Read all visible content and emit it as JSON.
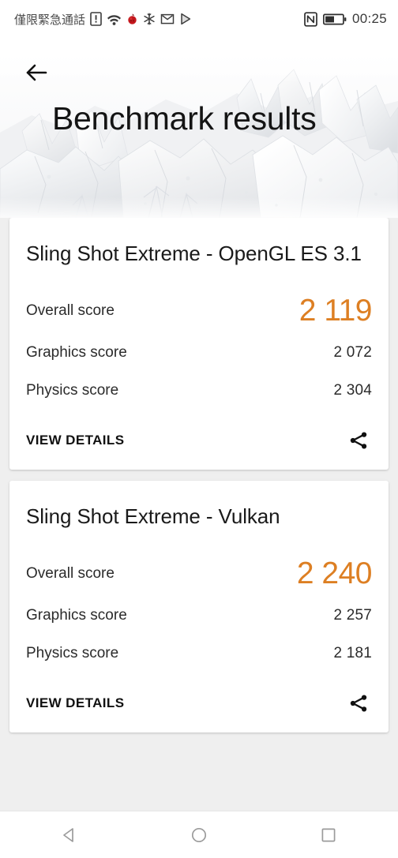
{
  "statusbar": {
    "carrier": "僅限緊急通話",
    "time": "00:25",
    "icons": [
      "sim-alert-icon",
      "wifi-icon",
      "app-notification-icon",
      "snowflake-icon",
      "gmail-icon",
      "play-store-icon"
    ],
    "right_icons": [
      "nfc-icon",
      "battery-icon"
    ],
    "battery_level": 50
  },
  "header": {
    "back_label": "back-arrow",
    "title": "Benchmark results"
  },
  "colors": {
    "accent_orange": "#dd7f23",
    "page_background": "#efefef",
    "card_background": "#ffffff",
    "text_primary": "#1a1a1a"
  },
  "labels": {
    "overall_score": "Overall score",
    "graphics_score": "Graphics score",
    "physics_score": "Physics score",
    "view_details": "VIEW DETAILS",
    "share": "share-icon"
  },
  "cards": [
    {
      "title": "Sling Shot Extreme - OpenGL ES 3.1",
      "overall_label": "Overall score",
      "overall_value": "2 119",
      "rows": [
        {
          "label": "Graphics score",
          "value": "2 072"
        },
        {
          "label": "Physics score",
          "value": "2 304"
        }
      ],
      "action_label": "VIEW DETAILS"
    },
    {
      "title": "Sling Shot Extreme - Vulkan",
      "overall_label": "Overall score",
      "overall_value": "2 240",
      "rows": [
        {
          "label": "Graphics score",
          "value": "2 257"
        },
        {
          "label": "Physics score",
          "value": "2 181"
        }
      ],
      "action_label": "VIEW DETAILS"
    }
  ],
  "navbar": {
    "back": "back-triangle-icon",
    "home": "home-circle-icon",
    "recents": "recents-square-icon"
  }
}
